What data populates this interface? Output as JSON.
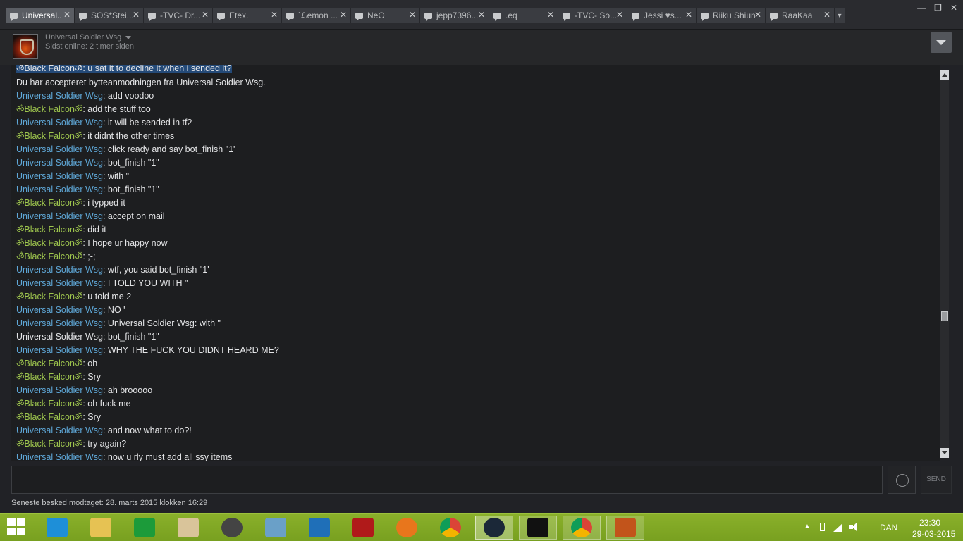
{
  "window": {
    "tabs": [
      {
        "label": "Universal..",
        "active": true
      },
      {
        "label": "SOS*Stei...",
        "active": false
      },
      {
        "label": "-TVC- Dr...",
        "active": false
      },
      {
        "label": "Etex.",
        "active": false
      },
      {
        "label": "`ℒemon ...",
        "active": false
      },
      {
        "label": "NeO",
        "active": false
      },
      {
        "label": "jepp7396...",
        "active": false
      },
      {
        "label": ".eq",
        "active": false
      },
      {
        "label": "-TVC- So...",
        "active": false
      },
      {
        "label": "Jessi ♥s...",
        "active": false
      },
      {
        "label": "Riiku Shiun",
        "active": false
      },
      {
        "label": "RaaKaa",
        "active": false
      }
    ],
    "close_glyph": "✕",
    "dropdown_glyph": "▼",
    "controls": {
      "minimize": "—",
      "maximize": "❐",
      "close": "✕"
    }
  },
  "header": {
    "friend_name": "Universal Soldier Wsg",
    "status": "Sidst online: 2 timer siden"
  },
  "chat": {
    "messages": [
      {
        "sender": "ॐBlack Falconॐ",
        "style": "plain",
        "text": ": u sat it to decline it when i sended it?"
      },
      {
        "sender": "",
        "style": "system",
        "text": "Du har accepteret bytteanmodningen fra Universal Soldier Wsg."
      },
      {
        "sender": "Universal Soldier Wsg",
        "style": "us",
        "text": ": add voodoo"
      },
      {
        "sender": "ॐBlack Falconॐ",
        "style": "bf",
        "text": ": add the stuff too"
      },
      {
        "sender": "Universal Soldier Wsg",
        "style": "us",
        "text": ": it will be sended in tf2"
      },
      {
        "sender": "ॐBlack Falconॐ",
        "style": "bf",
        "text": ": it didnt the other times"
      },
      {
        "sender": "Universal Soldier Wsg",
        "style": "us",
        "text": ": click ready and say bot_finish \"1'"
      },
      {
        "sender": "Universal Soldier Wsg",
        "style": "us",
        "text": ": bot_finish \"1\""
      },
      {
        "sender": "Universal Soldier Wsg",
        "style": "us",
        "text": ": with \""
      },
      {
        "sender": "Universal Soldier Wsg",
        "style": "us",
        "text": ": bot_finish \"1\""
      },
      {
        "sender": "ॐBlack Falconॐ",
        "style": "bf",
        "text": ": i typped it"
      },
      {
        "sender": "Universal Soldier Wsg",
        "style": "us",
        "text": ": accept on mail"
      },
      {
        "sender": "ॐBlack Falconॐ",
        "style": "bf",
        "text": ": did it"
      },
      {
        "sender": "ॐBlack Falconॐ",
        "style": "bf",
        "text": ": I hope ur happy now"
      },
      {
        "sender": "ॐBlack Falconॐ",
        "style": "bf",
        "text": ": ;-;"
      },
      {
        "sender": "Universal Soldier Wsg",
        "style": "us",
        "text": ": wtf, you said bot_finish \"1'"
      },
      {
        "sender": "Universal Soldier Wsg",
        "style": "us",
        "text": ": I TOLD YOU WITH \""
      },
      {
        "sender": "ॐBlack Falconॐ",
        "style": "bf",
        "text": ": u told me 2"
      },
      {
        "sender": "Universal Soldier Wsg",
        "style": "us",
        "text": ": NO '"
      },
      {
        "sender": "Universal Soldier Wsg",
        "style": "us",
        "text": ": Universal Soldier Wsg: with \""
      },
      {
        "sender": "Universal Soldier Wsg",
        "style": "plain",
        "text": ": bot_finish \"1\""
      },
      {
        "sender": "Universal Soldier Wsg",
        "style": "us",
        "text": ": WHY THE FUCK YOU DIDNT HEARD ME?"
      },
      {
        "sender": "ॐBlack Falconॐ",
        "style": "bf",
        "text": ": oh"
      },
      {
        "sender": "ॐBlack Falconॐ",
        "style": "bf",
        "text": ": Sry"
      },
      {
        "sender": "Universal Soldier Wsg",
        "style": "us",
        "text": ": ah brooooo"
      },
      {
        "sender": "ॐBlack Falconॐ",
        "style": "bf",
        "text": ": oh fuck me"
      },
      {
        "sender": "ॐBlack Falconॐ",
        "style": "bf",
        "text": ": Sry"
      },
      {
        "sender": "Universal Soldier Wsg",
        "style": "us",
        "text": ": and now what to do?!"
      },
      {
        "sender": "ॐBlack Falconॐ",
        "style": "bf",
        "text": ": try again?"
      },
      {
        "sender": "Universal Soldier Wsg",
        "style": "us",
        "text": ": now u rly must add all ssy items"
      }
    ],
    "colors": {
      "universal_soldier": "#5fa8d8",
      "black_falcon": "#9ec54e",
      "text": "#e3e4e6"
    }
  },
  "composer": {
    "message_value": "",
    "send_label": "SEND",
    "last_message": "Seneste besked modtaget: 28. marts 2015 klokken 16:29"
  },
  "taskbar": {
    "apps": [
      "internet-explorer-icon",
      "file-explorer-icon",
      "store-icon",
      "media-player-icon",
      "speaker-app-icon",
      "document-app-icon",
      "settings-app-icon",
      "power-app-icon",
      "firefox-icon",
      "chrome-icon",
      "steam-icon",
      "command-prompt-icon",
      "chrome-icon",
      "team-fortress-icon"
    ],
    "language": "DAN",
    "time": "23:30",
    "date": "29-03-2015",
    "tray_arrow": "▲",
    "accent": "#8ab02a"
  }
}
